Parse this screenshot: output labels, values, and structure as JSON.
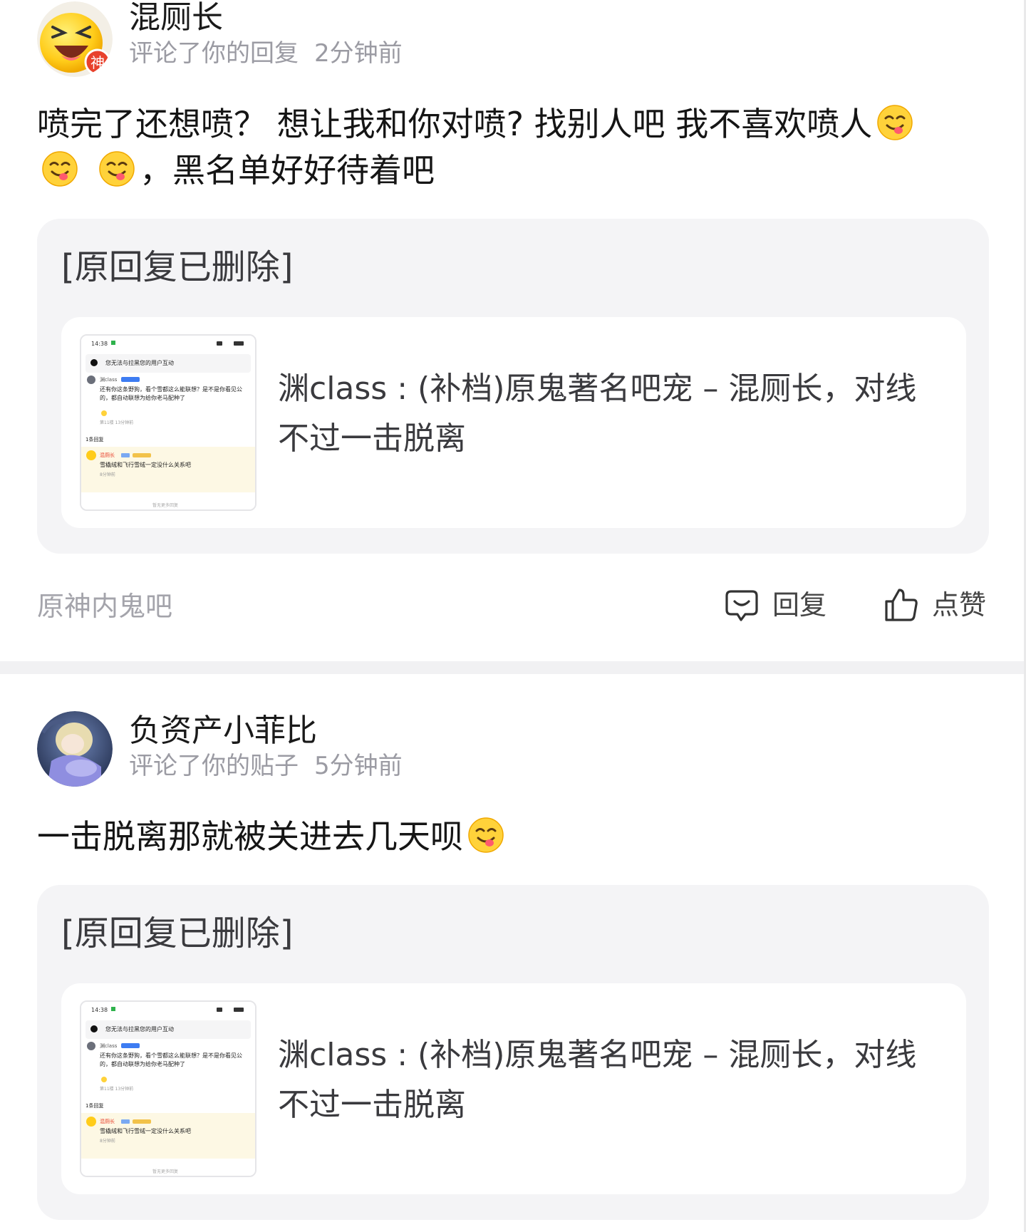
{
  "notifications": [
    {
      "username": "混厕长",
      "badge": "神",
      "action": "评论了你的回复",
      "time": "2分钟前",
      "content_line1": "喷完了还想喷？ 想让我和你对喷? 找别人吧 我不喜欢喷人",
      "content_line2": "，黑名单好好待着吧",
      "quote_deleted": "[原回复已删除]",
      "link_text": "渊class : (补档)原鬼著名吧宠 – 混厕长，对线不过一击脱离",
      "forum": "原神内鬼吧",
      "reply_label": "回复",
      "like_label": "点赞"
    },
    {
      "username": "负资产小菲比",
      "action": "评论了你的贴子",
      "time": "5分钟前",
      "content": "一击脱离那就被关进去几天呗",
      "quote_deleted": "[原回复已删除]",
      "link_text": "渊class : (补档)原鬼著名吧宠 – 混厕长，对线不过一击脱离"
    }
  ],
  "thumbnail": {
    "status_time": "14:38",
    "notice": "您无法与拉黑您的用户互动",
    "user1": "渊class",
    "post_text": "还有你这条野狗，看个雪都这么能联想？是不是你看见公的，都自动联想为给你老马配种了",
    "floor_info": "第11楼 13分钟前",
    "reply_count": "1条回复",
    "user2": "混厕长",
    "reply_text": "雪橇绒和飞行雪绒一定没什么关系吧",
    "reply_time": "8分钟前",
    "footer": "暂无更多回复"
  },
  "colors": {
    "accent_red": "#e8412c",
    "quote_bg": "#f4f4f6",
    "meta_gray": "#9b9ba3"
  },
  "icons": [
    "laugh-emoji-avatar",
    "yum-emoji",
    "comment-icon",
    "thumb-up-icon"
  ]
}
